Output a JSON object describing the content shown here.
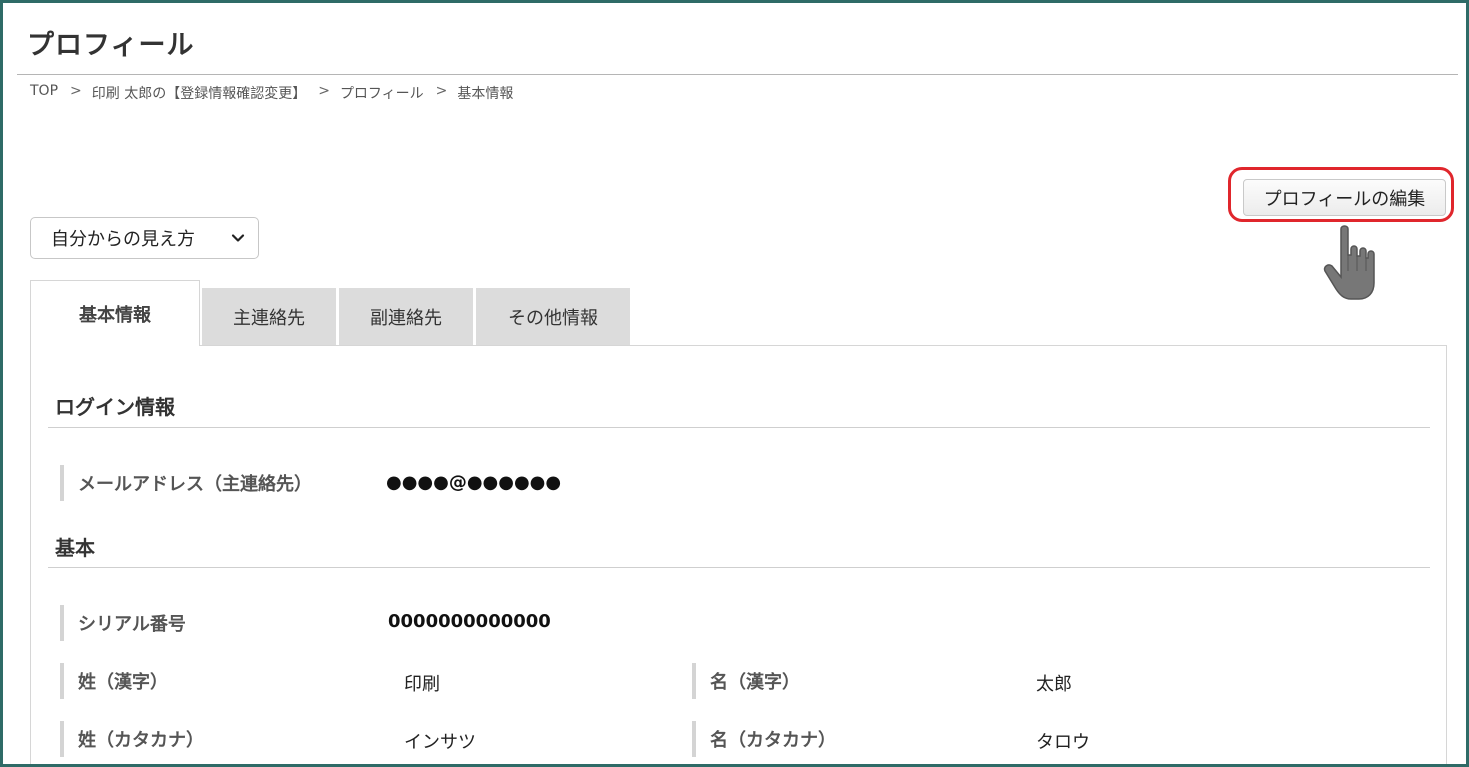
{
  "header": {
    "title": "プロフィール"
  },
  "breadcrumb": {
    "items": [
      "TOP",
      "印刷 太郎の【登録情報確認変更】",
      "プロフィール",
      "基本情報"
    ],
    "separator": ">"
  },
  "actions": {
    "edit_profile_label": "プロフィールの編集"
  },
  "view_select": {
    "selected": "自分からの見え方"
  },
  "tabs": [
    {
      "label": "基本情報",
      "active": true
    },
    {
      "label": "主連絡先",
      "active": false
    },
    {
      "label": "副連絡先",
      "active": false
    },
    {
      "label": "その他情報",
      "active": false
    }
  ],
  "sections": {
    "login": {
      "title": "ログイン情報",
      "email_label": "メールアドレス（主連絡先）",
      "email_value": "●●●●@●●●●●●"
    },
    "basic": {
      "title": "基本",
      "serial_label": "シリアル番号",
      "serial_value": "0000000000000",
      "last_name_kanji_label": "姓（漢字）",
      "last_name_kanji_value": "印刷",
      "first_name_kanji_label": "名（漢字）",
      "first_name_kanji_value": "太郎",
      "last_name_kana_label": "姓（カタカナ）",
      "last_name_kana_value": "インサツ",
      "first_name_kana_label": "名（カタカナ）",
      "first_name_kana_value": "タロウ"
    }
  },
  "colors": {
    "frame": "#2f6b67",
    "highlight": "#e0262c",
    "tab_inactive": "#dcdcdc"
  },
  "icons": {
    "pointer": "hand-pointer-icon",
    "select_arrow": "chevron-down-icon"
  }
}
